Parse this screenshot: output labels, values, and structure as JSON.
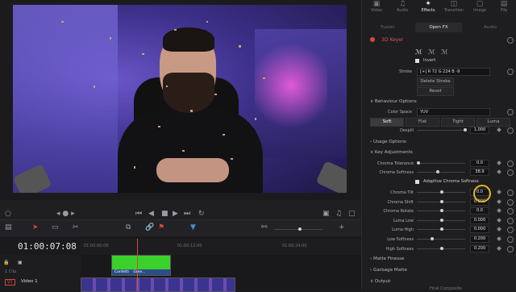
{
  "viewer": {
    "timeline_nav": "◂ ● ▸"
  },
  "timeline": {
    "timecode": "01:00:07:08",
    "ruler": [
      "01:00:00:00",
      "01:00:12:00",
      "01:00:24:00"
    ],
    "tracks": [
      {
        "id": "V2",
        "name": ""
      },
      {
        "id": "V1",
        "name": "Video 1"
      }
    ],
    "clips": {
      "green": "Confetti",
      "green2": "Gree...",
      "video": ""
    },
    "clip_label_v2": "1 Clip"
  },
  "inspector": {
    "tabs": [
      "Video",
      "Audio",
      "Effects",
      "Transition",
      "Image",
      "File"
    ],
    "active_tab": "Effects",
    "subtabs": [
      "Fusion",
      "Open FX",
      "Audio"
    ],
    "active_subtab": "Open FX",
    "effect_name": "3D Keyer",
    "invert_label": "Invert",
    "stroke_label": "Stroke",
    "stroke_value": "R 72  G 224  B -9",
    "delete_stroke": "Delete Stroke",
    "reset": "Reset",
    "behaviour": "Behaviour Options",
    "color_space_label": "Color Space",
    "color_space_value": "YUV",
    "modes": [
      "Soft",
      "Flat",
      "Tight",
      "Luma"
    ],
    "despill_label": "Despill",
    "despill_value": "1.000",
    "usage": "Usage Options",
    "key_adj": "Key Adjustments",
    "chroma_tol_label": "Chroma Tolerance",
    "chroma_tol_value": "0.0",
    "chroma_soft_label": "Chroma Softness",
    "chroma_soft_value": "38.9",
    "adaptive_label": "Adaptive Chroma Softness",
    "rows": [
      {
        "label": "Chroma Tilt",
        "value": "0.0"
      },
      {
        "label": "Chroma Shift",
        "value": "0.000"
      },
      {
        "label": "Chroma Rotate",
        "value": "0.0"
      },
      {
        "label": "Luma Low",
        "value": "0.000"
      },
      {
        "label": "Luma High",
        "value": "0.000"
      },
      {
        "label": "Low Softness",
        "value": "0.200"
      },
      {
        "label": "High Softness",
        "value": "0.200"
      }
    ],
    "matte_finesse": "Matte Finesse",
    "garbage_matte": "Garbage Matte",
    "output": "Output",
    "output_value": "Final Composite"
  }
}
